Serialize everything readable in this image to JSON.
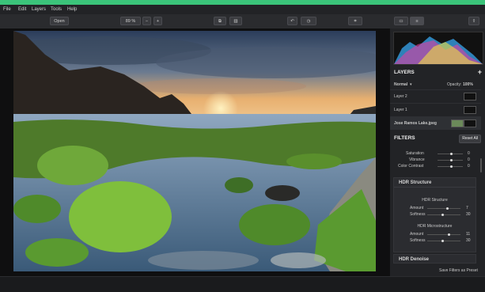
{
  "menu": [
    "File",
    "Edit",
    "Layers",
    "Tools",
    "Help"
  ],
  "toolbar": {
    "open_label": "Open",
    "zoom_value": "89 %"
  },
  "layers": {
    "title": "LAYERS",
    "blend_mode": "Normal",
    "opacity_label": "Opacity:",
    "opacity_value": "100%",
    "items": [
      {
        "label": "Layer 2"
      },
      {
        "label": "Layer 1"
      },
      {
        "label": "Jose Ramos Lake.jpeg"
      }
    ]
  },
  "filters": {
    "title": "FILTERS",
    "reset_label": "Reset All",
    "top_sliders": [
      {
        "label": "Saturation",
        "value": "0"
      },
      {
        "label": "Vibrance",
        "value": "0"
      },
      {
        "label": "Color Contrast",
        "value": "0"
      }
    ],
    "hdr_structure": {
      "title": "HDR Structure",
      "sub1_title": "HDR Structure",
      "sub1": [
        {
          "label": "Amount",
          "value": "7"
        },
        {
          "label": "Softness",
          "value": "30"
        }
      ],
      "sub2_title": "HDR Microstructure",
      "sub2": [
        {
          "label": "Amount",
          "value": "11"
        },
        {
          "label": "Softness",
          "value": "30"
        }
      ]
    },
    "hdr_denoise": {
      "title": "HDR Denoise"
    },
    "save_preset_label": "Save Filters as Preset"
  },
  "icons": [
    "crop-icon",
    "compare-icon",
    "undo-icon",
    "history-icon",
    "export-icon",
    "share-icon",
    "panel-toggle-icon",
    "layers-mode-icon",
    "plus-icon",
    "chevron-down-icon"
  ],
  "colors": {
    "accent": "#3bc47a"
  }
}
